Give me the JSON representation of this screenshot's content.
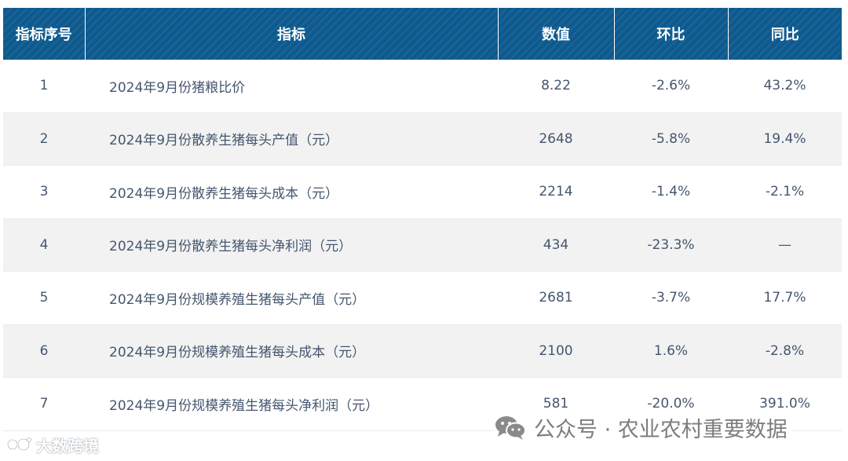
{
  "chart_data": {
    "type": "table",
    "columns": [
      "指标序号",
      "指标",
      "数值",
      "环比",
      "同比"
    ],
    "rows": [
      [
        "1",
        "2024年9月份猪粮比价",
        "8.22",
        "-2.6%",
        "43.2%"
      ],
      [
        "2",
        "2024年9月份散养生猪每头产值（元）",
        "2648",
        "-5.8%",
        "19.4%"
      ],
      [
        "3",
        "2024年9月份散养生猪每头成本（元）",
        "2214",
        "-1.4%",
        "-2.1%"
      ],
      [
        "4",
        "2024年9月份散养生猪每头净利润（元）",
        "434",
        "-23.3%",
        "—"
      ],
      [
        "5",
        "2024年9月份规模养殖生猪每头产值（元）",
        "2681",
        "-3.7%",
        "17.7%"
      ],
      [
        "6",
        "2024年9月份规模养殖生猪每头成本（元）",
        "2100",
        "1.6%",
        "-2.8%"
      ],
      [
        "7",
        "2024年9月份规模养殖生猪每头净利润（元）",
        "581",
        "-20.0%",
        "391.0%"
      ]
    ]
  },
  "colors": {
    "header_bg": "#0e5a8e",
    "header_text": "#ffffff",
    "row_alt_bg": "#f2f2f2",
    "body_text": "#44566e"
  },
  "watermarks": {
    "left": "大数跨境",
    "right": "公众号 · 农业农村重要数据"
  },
  "icons": {
    "left": "logo-icon",
    "right": "wechat-icon"
  }
}
